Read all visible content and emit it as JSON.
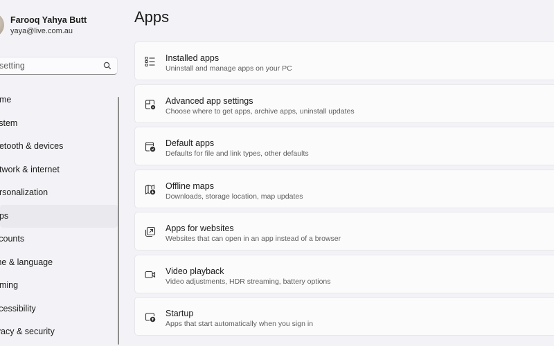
{
  "user": {
    "name": "Farooq Yahya Butt",
    "email": "yaya@live.com.au"
  },
  "search": {
    "text": "setting"
  },
  "nav": {
    "items": [
      {
        "label": "ome"
      },
      {
        "label": "ystem"
      },
      {
        "label": "uetooth & devices"
      },
      {
        "label": "etwork & internet"
      },
      {
        "label": "ersonalization"
      },
      {
        "label": "pps",
        "active": true
      },
      {
        "label": "ccounts"
      },
      {
        "label": "me & language"
      },
      {
        "label": "aming"
      },
      {
        "label": "ccessibility"
      },
      {
        "label": "ivacy & security"
      }
    ]
  },
  "page": {
    "title": "Apps"
  },
  "cards": [
    {
      "icon": "installed-apps-icon",
      "title": "Installed apps",
      "subtitle": "Uninstall and manage apps on your PC"
    },
    {
      "icon": "advanced-app-settings-icon",
      "title": "Advanced app settings",
      "subtitle": "Choose where to get apps, archive apps, uninstall updates"
    },
    {
      "icon": "default-apps-icon",
      "title": "Default apps",
      "subtitle": "Defaults for file and link types, other defaults"
    },
    {
      "icon": "offline-maps-icon",
      "title": "Offline maps",
      "subtitle": "Downloads, storage location, map updates"
    },
    {
      "icon": "apps-for-websites-icon",
      "title": "Apps for websites",
      "subtitle": "Websites that can open in an app instead of a browser"
    },
    {
      "icon": "video-playback-icon",
      "title": "Video playback",
      "subtitle": "Video adjustments, HDR streaming, battery options"
    },
    {
      "icon": "startup-icon",
      "title": "Startup",
      "subtitle": "Apps that start automatically when you sign in"
    }
  ]
}
